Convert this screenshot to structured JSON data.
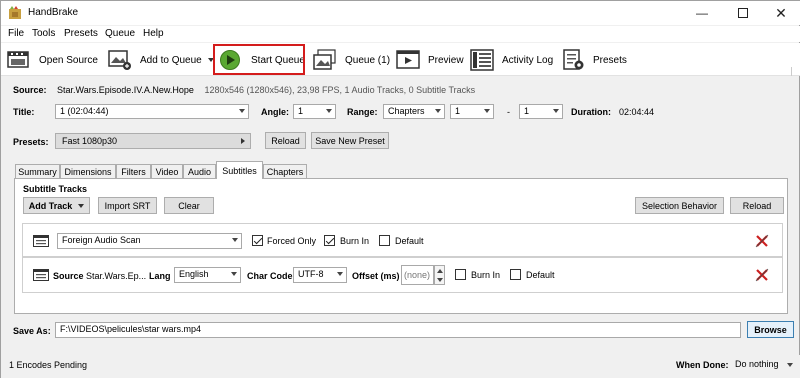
{
  "window": {
    "title": "HandBrake"
  },
  "menu": [
    "File",
    "Tools",
    "Presets",
    "Queue",
    "Help"
  ],
  "toolbar": {
    "open_source": "Open Source",
    "add_to_queue": "Add to Queue",
    "start_queue": "Start Queue",
    "queue": "Queue (1)",
    "preview": "Preview",
    "activity_log": "Activity Log",
    "presets": "Presets"
  },
  "source": {
    "label": "Source:",
    "name": "Star.Wars.Episode.IV.A.New.Hope",
    "info": "1280x546 (1280x546), 23,98 FPS, 1 Audio Tracks, 0 Subtitle Tracks"
  },
  "title_row": {
    "title_label": "Title:",
    "title_value": "1 (02:04:44)",
    "angle_label": "Angle:",
    "angle_value": "1",
    "range_label": "Range:",
    "range_type": "Chapters",
    "range_start": "1",
    "dash": "-",
    "range_end": "1",
    "duration_label": "Duration:",
    "duration_value": "02:04:44"
  },
  "presets_row": {
    "label": "Presets:",
    "value": "Fast 1080p30",
    "reload": "Reload",
    "save_new": "Save New Preset"
  },
  "tabs": [
    "Summary",
    "Dimensions",
    "Filters",
    "Video",
    "Audio",
    "Subtitles",
    "Chapters"
  ],
  "active_tab": "Subtitles",
  "subtitles": {
    "heading": "Subtitle Tracks",
    "add_track": "Add Track",
    "import_srt": "Import SRT",
    "clear": "Clear",
    "selection_behavior": "Selection Behavior",
    "reload": "Reload",
    "row1": {
      "track": "Foreign Audio Scan",
      "forced_only": "Forced Only",
      "burn_in": "Burn In",
      "default": "Default",
      "forced_checked": true,
      "burn_checked": true,
      "default_checked": false
    },
    "row2": {
      "source_label": "Source",
      "source_value": "Star.Wars.Ep...",
      "lang_label": "Lang",
      "lang_value": "English",
      "charcode_label": "Char Code",
      "charcode_value": "UTF-8",
      "offset_label": "Offset (ms)",
      "offset_placeholder": "(none)",
      "burn_in": "Burn In",
      "default": "Default"
    }
  },
  "save_as": {
    "label": "Save As:",
    "value": "F:\\VIDEOS\\pelicules\\star wars.mp4",
    "browse": "Browse"
  },
  "status": {
    "encodes": "1 Encodes Pending",
    "when_done_label": "When Done:",
    "when_done_value": "Do nothing"
  }
}
